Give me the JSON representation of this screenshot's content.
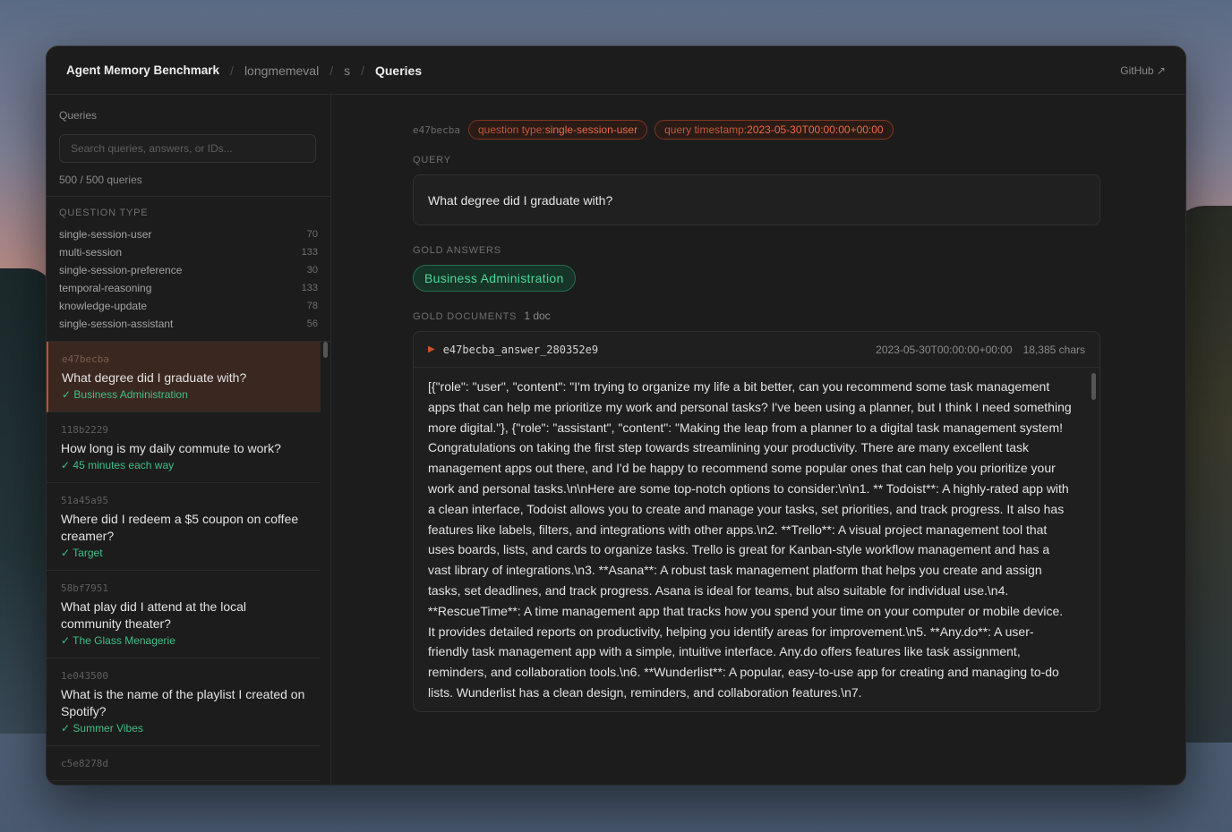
{
  "header": {
    "brand": "Agent Memory Benchmark",
    "crumb_dataset": "longmemeval",
    "crumb_split": "s",
    "crumb_current": "Queries",
    "github": "GitHub ↗"
  },
  "sidebar": {
    "title": "Queries",
    "search_placeholder": "Search queries, answers, or IDs...",
    "count": "500 / 500 queries",
    "question_type_label": "Question type",
    "question_types": [
      {
        "name": "single-session-user",
        "count": "70"
      },
      {
        "name": "multi-session",
        "count": "133"
      },
      {
        "name": "single-session-preference",
        "count": "30"
      },
      {
        "name": "temporal-reasoning",
        "count": "133"
      },
      {
        "name": "knowledge-update",
        "count": "78"
      },
      {
        "name": "single-session-assistant",
        "count": "56"
      }
    ],
    "queries": [
      {
        "id": "e47becba",
        "question": "What degree did I graduate with?",
        "answer": "✓ Business Administration"
      },
      {
        "id": "118b2229",
        "question": "How long is my daily commute to work?",
        "answer": "✓ 45 minutes each way"
      },
      {
        "id": "51a45a95",
        "question": "Where did I redeem a $5 coupon on coffee creamer?",
        "answer": "✓ Target"
      },
      {
        "id": "58bf7951",
        "question": "What play did I attend at the local community theater?",
        "answer": "✓ The Glass Menagerie"
      },
      {
        "id": "1e043500",
        "question": "What is the name of the playlist I created on Spotify?",
        "answer": "✓ Summer Vibes"
      },
      {
        "id": "c5e8278d",
        "question": "",
        "answer": ""
      }
    ]
  },
  "detail": {
    "id": "e47becba",
    "tag_type_key": "question type:",
    "tag_type_value": "single-session-user",
    "tag_time_key": "query timestamp:",
    "tag_time_value": "2023-05-30T00:00:00+00:00",
    "query_label": "Query",
    "query": "What degree did I graduate with?",
    "gold_answers_label": "Gold answers",
    "gold_answer": "Business Administration",
    "gold_docs_label": "Gold documents",
    "gold_docs_count": "1 doc",
    "doc": {
      "name": "e47becba_answer_280352e9",
      "timestamp": "2023-05-30T00:00:00+00:00",
      "size": "18,385 chars",
      "text": "[{\"role\": \"user\", \"content\": \"I'm trying to organize my life a bit better, can you recommend some task management apps that can help me prioritize my work and personal tasks? I've been using a planner, but I think I need something more digital.\"}, {\"role\": \"assistant\", \"content\": \"Making the leap from a planner to a digital task management system! Congratulations on taking the first step towards streamlining your productivity. There are many excellent task management apps out there, and I'd be happy to recommend some popular ones that can help you prioritize your work and personal tasks.\\n\\nHere are some top-notch options to consider:\\n\\n1. ** Todoist**: A highly-rated app with a clean interface, Todoist allows you to create and manage your tasks, set priorities, and track progress. It also has features like labels, filters, and integrations with other apps.\\n2. **Trello**: A visual project management tool that uses boards, lists, and cards to organize tasks. Trello is great for Kanban-style workflow management and has a vast library of integrations.\\n3. **Asana**: A robust task management platform that helps you create and assign tasks, set deadlines, and track progress. Asana is ideal for teams, but also suitable for individual use.\\n4. **RescueTime**: A time management app that tracks how you spend your time on your computer or mobile device. It provides detailed reports on productivity, helping you identify areas for improvement.\\n5. **Any.do**: A user-friendly task management app with a simple, intuitive interface. Any.do offers features like task assignment, reminders, and collaboration tools.\\n6. **Wunderlist**: A popular, easy-to-use app for creating and managing to-do lists. Wunderlist has a clean design, reminders, and collaboration features.\\n7."
    }
  },
  "colors": {
    "accent": "#c0502d",
    "answer_green": "#3fbf86",
    "panel_bg": "#1c1c1c"
  }
}
